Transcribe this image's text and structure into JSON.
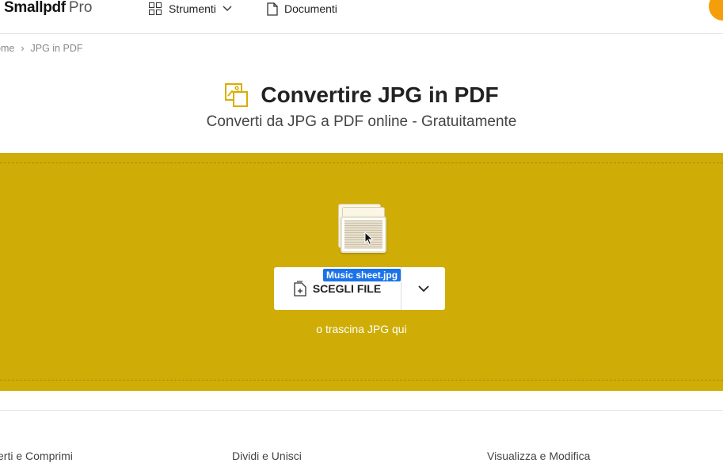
{
  "header": {
    "brand": "Smallpdf",
    "pro": "Pro",
    "nav": {
      "tools_label": "Strumenti",
      "documents_label": "Documenti"
    },
    "avatar_color": "#f59e0b"
  },
  "breadcrumb": {
    "home": "ome",
    "separator": "›",
    "current": "JPG in PDF"
  },
  "hero": {
    "title": "Convertire JPG in PDF",
    "subtitle": "Converti da JPG a PDF online - Gratuitamente"
  },
  "dropzone": {
    "color": "#cfad06",
    "choose_label": "SCEGLI FILE",
    "drag_file_name": "Music sheet.jpg",
    "hint": "o trascina JPG qui"
  },
  "categories": [
    "verti e Comprimi",
    "Dividi e Unisci",
    "Visualizza e Modifica"
  ]
}
